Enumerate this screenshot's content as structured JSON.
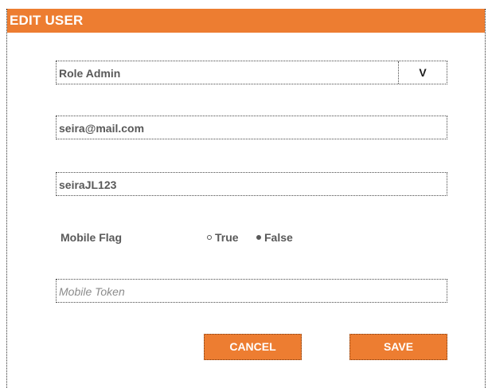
{
  "dialog": {
    "title": "EDIT USER"
  },
  "form": {
    "role": {
      "value": "Role Admin",
      "toggle_label": "V"
    },
    "email": {
      "value": "seira@mail.com"
    },
    "password": {
      "value": "seiraJL123"
    },
    "mobile_flag": {
      "label": "Mobile Flag",
      "options": [
        {
          "label": "True",
          "selected": false
        },
        {
          "label": "False",
          "selected": true
        }
      ]
    },
    "mobile_token": {
      "value": "",
      "placeholder": "Mobile Token"
    }
  },
  "actions": {
    "cancel_label": "CANCEL",
    "save_label": "SAVE"
  },
  "colors": {
    "accent": "#ED7D31",
    "text": "#595959"
  }
}
